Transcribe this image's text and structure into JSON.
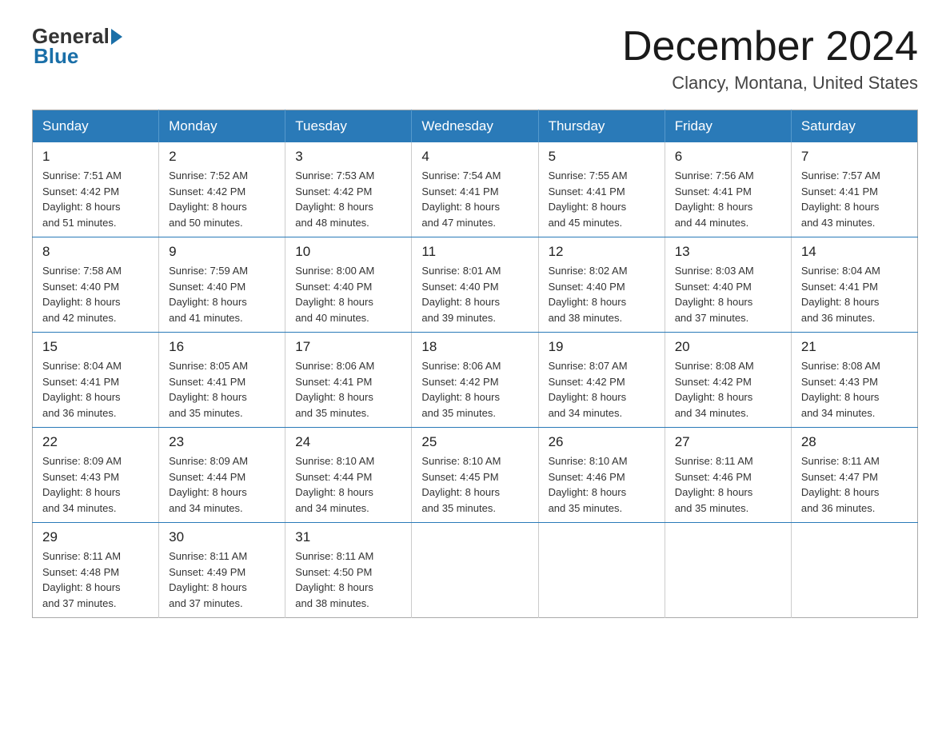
{
  "logo": {
    "general": "General",
    "blue": "Blue"
  },
  "header": {
    "month": "December 2024",
    "location": "Clancy, Montana, United States"
  },
  "weekdays": [
    "Sunday",
    "Monday",
    "Tuesday",
    "Wednesday",
    "Thursday",
    "Friday",
    "Saturday"
  ],
  "weeks": [
    [
      {
        "day": "1",
        "sunrise": "7:51 AM",
        "sunset": "4:42 PM",
        "daylight": "8 hours and 51 minutes."
      },
      {
        "day": "2",
        "sunrise": "7:52 AM",
        "sunset": "4:42 PM",
        "daylight": "8 hours and 50 minutes."
      },
      {
        "day": "3",
        "sunrise": "7:53 AM",
        "sunset": "4:42 PM",
        "daylight": "8 hours and 48 minutes."
      },
      {
        "day": "4",
        "sunrise": "7:54 AM",
        "sunset": "4:41 PM",
        "daylight": "8 hours and 47 minutes."
      },
      {
        "day": "5",
        "sunrise": "7:55 AM",
        "sunset": "4:41 PM",
        "daylight": "8 hours and 45 minutes."
      },
      {
        "day": "6",
        "sunrise": "7:56 AM",
        "sunset": "4:41 PM",
        "daylight": "8 hours and 44 minutes."
      },
      {
        "day": "7",
        "sunrise": "7:57 AM",
        "sunset": "4:41 PM",
        "daylight": "8 hours and 43 minutes."
      }
    ],
    [
      {
        "day": "8",
        "sunrise": "7:58 AM",
        "sunset": "4:40 PM",
        "daylight": "8 hours and 42 minutes."
      },
      {
        "day": "9",
        "sunrise": "7:59 AM",
        "sunset": "4:40 PM",
        "daylight": "8 hours and 41 minutes."
      },
      {
        "day": "10",
        "sunrise": "8:00 AM",
        "sunset": "4:40 PM",
        "daylight": "8 hours and 40 minutes."
      },
      {
        "day": "11",
        "sunrise": "8:01 AM",
        "sunset": "4:40 PM",
        "daylight": "8 hours and 39 minutes."
      },
      {
        "day": "12",
        "sunrise": "8:02 AM",
        "sunset": "4:40 PM",
        "daylight": "8 hours and 38 minutes."
      },
      {
        "day": "13",
        "sunrise": "8:03 AM",
        "sunset": "4:40 PM",
        "daylight": "8 hours and 37 minutes."
      },
      {
        "day": "14",
        "sunrise": "8:04 AM",
        "sunset": "4:41 PM",
        "daylight": "8 hours and 36 minutes."
      }
    ],
    [
      {
        "day": "15",
        "sunrise": "8:04 AM",
        "sunset": "4:41 PM",
        "daylight": "8 hours and 36 minutes."
      },
      {
        "day": "16",
        "sunrise": "8:05 AM",
        "sunset": "4:41 PM",
        "daylight": "8 hours and 35 minutes."
      },
      {
        "day": "17",
        "sunrise": "8:06 AM",
        "sunset": "4:41 PM",
        "daylight": "8 hours and 35 minutes."
      },
      {
        "day": "18",
        "sunrise": "8:06 AM",
        "sunset": "4:42 PM",
        "daylight": "8 hours and 35 minutes."
      },
      {
        "day": "19",
        "sunrise": "8:07 AM",
        "sunset": "4:42 PM",
        "daylight": "8 hours and 34 minutes."
      },
      {
        "day": "20",
        "sunrise": "8:08 AM",
        "sunset": "4:42 PM",
        "daylight": "8 hours and 34 minutes."
      },
      {
        "day": "21",
        "sunrise": "8:08 AM",
        "sunset": "4:43 PM",
        "daylight": "8 hours and 34 minutes."
      }
    ],
    [
      {
        "day": "22",
        "sunrise": "8:09 AM",
        "sunset": "4:43 PM",
        "daylight": "8 hours and 34 minutes."
      },
      {
        "day": "23",
        "sunrise": "8:09 AM",
        "sunset": "4:44 PM",
        "daylight": "8 hours and 34 minutes."
      },
      {
        "day": "24",
        "sunrise": "8:10 AM",
        "sunset": "4:44 PM",
        "daylight": "8 hours and 34 minutes."
      },
      {
        "day": "25",
        "sunrise": "8:10 AM",
        "sunset": "4:45 PM",
        "daylight": "8 hours and 35 minutes."
      },
      {
        "day": "26",
        "sunrise": "8:10 AM",
        "sunset": "4:46 PM",
        "daylight": "8 hours and 35 minutes."
      },
      {
        "day": "27",
        "sunrise": "8:11 AM",
        "sunset": "4:46 PM",
        "daylight": "8 hours and 35 minutes."
      },
      {
        "day": "28",
        "sunrise": "8:11 AM",
        "sunset": "4:47 PM",
        "daylight": "8 hours and 36 minutes."
      }
    ],
    [
      {
        "day": "29",
        "sunrise": "8:11 AM",
        "sunset": "4:48 PM",
        "daylight": "8 hours and 37 minutes."
      },
      {
        "day": "30",
        "sunrise": "8:11 AM",
        "sunset": "4:49 PM",
        "daylight": "8 hours and 37 minutes."
      },
      {
        "day": "31",
        "sunrise": "8:11 AM",
        "sunset": "4:50 PM",
        "daylight": "8 hours and 38 minutes."
      },
      null,
      null,
      null,
      null
    ]
  ],
  "labels": {
    "sunrise": "Sunrise:",
    "sunset": "Sunset:",
    "daylight": "Daylight:"
  }
}
